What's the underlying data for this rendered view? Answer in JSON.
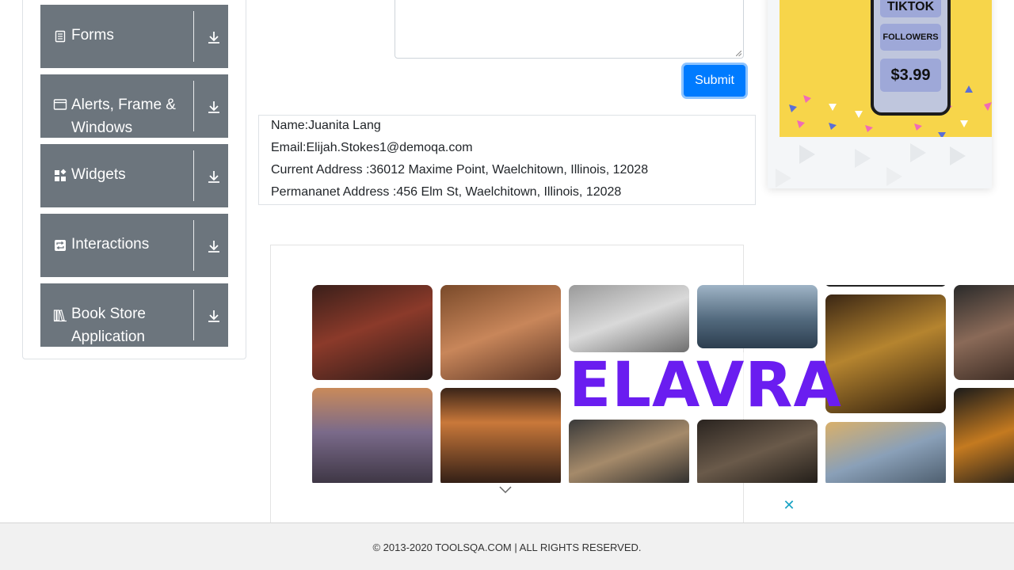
{
  "sidebar": {
    "groups": [
      {
        "label": "Forms",
        "icon": "document-icon"
      },
      {
        "label": "Alerts, Frame & Windows",
        "icon": "window-icon"
      },
      {
        "label": "Widgets",
        "icon": "widgets-icon"
      },
      {
        "label": "Interactions",
        "icon": "interactions-icon"
      },
      {
        "label": "Book Store Application",
        "icon": "books-icon"
      }
    ],
    "label_lines": {
      "alerts_1": "Alerts, Frame &",
      "alerts_2": "Windows",
      "book_1": "Book Store",
      "book_2": "Application"
    },
    "expand_icon": "download-arrow-icon"
  },
  "form": {
    "submit_label": "Submit"
  },
  "output": {
    "name": "Name:Juanita Lang",
    "email": "Email:Elijah.Stokes1@demoqa.com",
    "current_address": "Current Address :36012 Maxime Point, Waelchitown, Illinois, 12028",
    "permanent_address": "Permananet Address :456 Elm St, Waelchitown, Illinois, 12028"
  },
  "ad_right": {
    "line1": "TIKTOK",
    "line2": "FOLLOWERS",
    "price": "$3.99"
  },
  "ad_banner": {
    "brand": "ELAVRA",
    "close_icon": "close-x-icon",
    "expand_icon": "chevron-down-icon"
  },
  "footer": {
    "copyright": "© 2013-2020 TOOLSQA.COM | ALL RIGHTS RESERVED."
  },
  "colors": {
    "group_bg": "#6c757d",
    "submit_bg": "#007bff",
    "brand_purple": "#6a1df0",
    "ad_yellow": "#f7d54a",
    "close_x": "#1aa3c4"
  }
}
